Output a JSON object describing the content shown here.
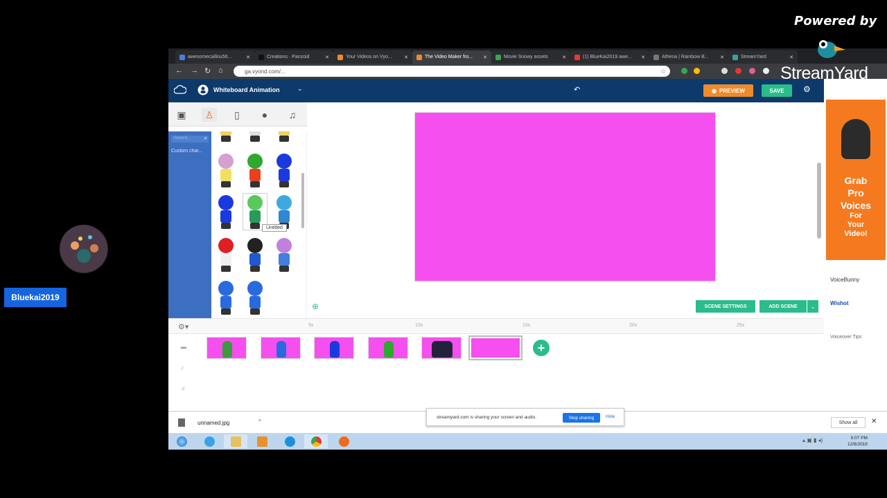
{
  "overlay": {
    "powered_by": "Powered by",
    "brand": "StreamYard",
    "participant_name": "Bluekai2019"
  },
  "browser": {
    "tabs": [
      {
        "label": "awesomecaillou56...",
        "color": "#4a7fe0"
      },
      {
        "label": "Creations · Panzoid",
        "color": "#111111"
      },
      {
        "label": "Your Videos on Vyo...",
        "color": "#f08a2a"
      },
      {
        "label": "The Video Maker fro...",
        "color": "#f08a2a"
      },
      {
        "label": "Movie Snowy assets",
        "color": "#34a853"
      },
      {
        "label": "(1) BlueKai2019 awe...",
        "color": "#e53935"
      },
      {
        "label": "Athena | Rainbow B...",
        "color": "#777777"
      },
      {
        "label": "StreamYard",
        "color": "#3aa0a0"
      }
    ],
    "url": "ga.vyond.com/..."
  },
  "app": {
    "title": "Whiteboard Animation",
    "preview_label": "PREVIEW",
    "save_label": "SAVE",
    "search_placeholder": "Search...",
    "custom_category": "Custom char...",
    "tooltip": "Untitled",
    "scene_settings_label": "SCENE SETTINGS",
    "add_scene_label": "ADD SCENE",
    "stage_color": "#f54ff0",
    "accent_green": "#2abd8a",
    "accent_orange": "#f08a2a"
  },
  "timeline": {
    "ticks": [
      "5s",
      "10s",
      "15s",
      "20s",
      "25s"
    ]
  },
  "ad": {
    "line1": "Grab",
    "line2": "Pro",
    "line3": "Voices",
    "line4": "For",
    "line5": "Your",
    "line6": "Video!",
    "brand1": "VoiceBunny",
    "brand2": "Wishot",
    "brand3": "Voiceover Tips"
  },
  "downloads": {
    "file_name": "unnamed.jpg",
    "show_all": "Show all"
  },
  "share_bar": {
    "message": "streamyard.com is sharing your screen and audio.",
    "stop_label": "Stop sharing",
    "hide_label": "Hide"
  },
  "taskbar": {
    "time": "5:07 PM",
    "date": "12/8/2019"
  }
}
